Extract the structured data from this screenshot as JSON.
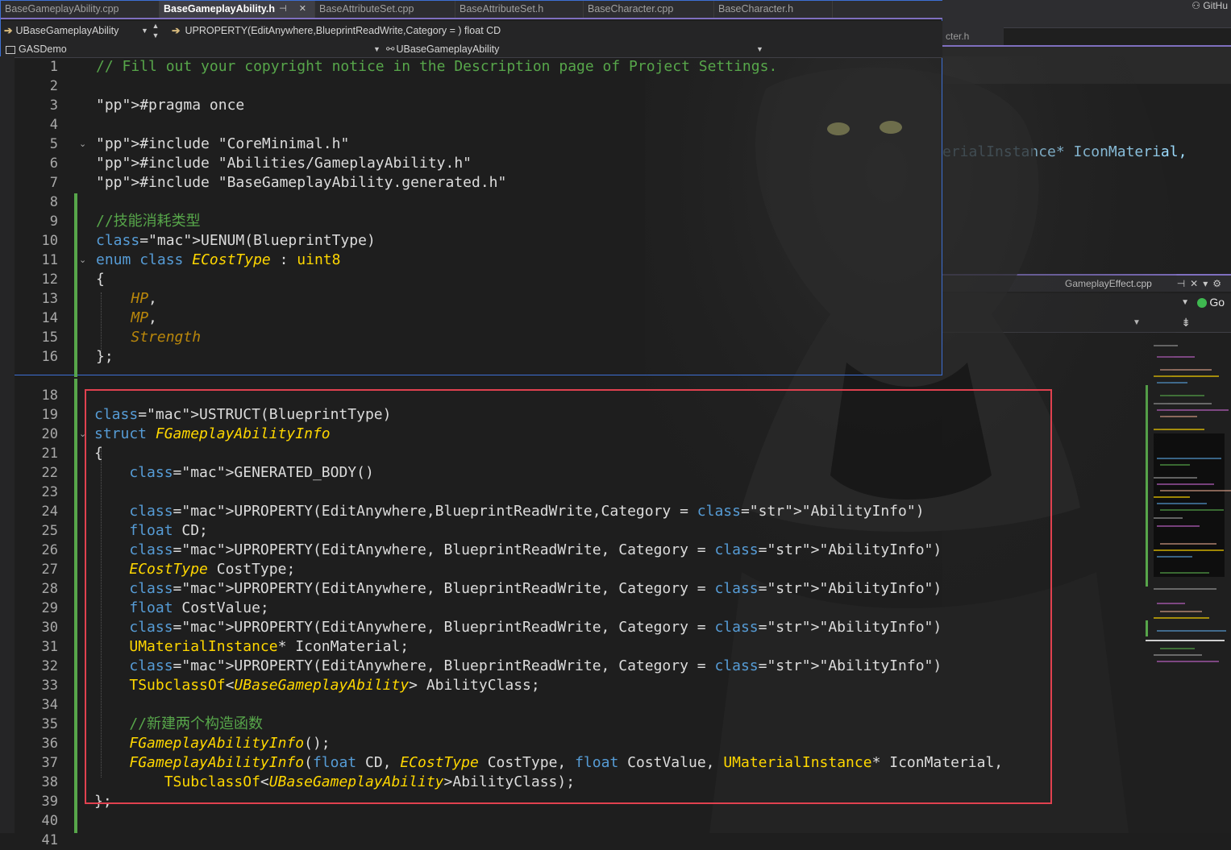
{
  "main_editor": {
    "tabs": [
      {
        "label": "BaseGameplayAbility.cpp",
        "active": false
      },
      {
        "label": "BaseGameplayAbility.h",
        "active": true
      },
      {
        "label": "BaseAttributeSet.cpp",
        "active": false
      },
      {
        "label": "BaseAttributeSet.h",
        "active": false
      },
      {
        "label": "BaseCharacter.cpp",
        "active": false
      },
      {
        "label": "BaseCharacter.h",
        "active": false
      }
    ],
    "active_tab_icons": "⊣ ✕",
    "nav": {
      "class_selector": "UBaseGameplayAbility",
      "member_selector": "UPROPERTY(EditAnywhere,BlueprintReadWrite,Category = ) float CD",
      "project": "GASDemo",
      "scope": "UBaseGameplayAbility"
    },
    "code_lines": [
      {
        "n": "1",
        "text": "// Fill out your copyright notice in the Description page of Project Settings."
      },
      {
        "n": "2",
        "text": ""
      },
      {
        "n": "3",
        "text": "#pragma once"
      },
      {
        "n": "4",
        "text": ""
      },
      {
        "n": "5",
        "text": "#include \"CoreMinimal.h\""
      },
      {
        "n": "6",
        "text": "#include \"Abilities/GameplayAbility.h\""
      },
      {
        "n": "7",
        "text": "#include \"BaseGameplayAbility.generated.h\""
      },
      {
        "n": "8",
        "text": ""
      },
      {
        "n": "9",
        "text": "//技能消耗类型"
      },
      {
        "n": "10",
        "text": "UENUM(BlueprintType)"
      },
      {
        "n": "11",
        "text": "enum class ECostType : uint8"
      },
      {
        "n": "12",
        "text": "{"
      },
      {
        "n": "13",
        "text": "    HP,"
      },
      {
        "n": "14",
        "text": "    MP,"
      },
      {
        "n": "15",
        "text": "    Strength"
      },
      {
        "n": "16",
        "text": "};"
      },
      {
        "n": "18",
        "text": ""
      },
      {
        "n": "19",
        "text": "USTRUCT(BlueprintType)"
      },
      {
        "n": "20",
        "text": "struct FGameplayAbilityInfo"
      },
      {
        "n": "21",
        "text": "{"
      },
      {
        "n": "22",
        "text": "    GENERATED_BODY()"
      },
      {
        "n": "23",
        "text": ""
      },
      {
        "n": "24",
        "text": "    UPROPERTY(EditAnywhere,BlueprintReadWrite,Category = \"AbilityInfo\")"
      },
      {
        "n": "25",
        "text": "    float CD;"
      },
      {
        "n": "26",
        "text": "    UPROPERTY(EditAnywhere, BlueprintReadWrite, Category = \"AbilityInfo\")"
      },
      {
        "n": "27",
        "text": "    ECostType CostType;"
      },
      {
        "n": "28",
        "text": "    UPROPERTY(EditAnywhere, BlueprintReadWrite, Category = \"AbilityInfo\")"
      },
      {
        "n": "29",
        "text": "    float CostValue;"
      },
      {
        "n": "30",
        "text": "    UPROPERTY(EditAnywhere, BlueprintReadWrite, Category = \"AbilityInfo\")"
      },
      {
        "n": "31",
        "text": "    UMaterialInstance* IconMaterial;"
      },
      {
        "n": "32",
        "text": "    UPROPERTY(EditAnywhere, BlueprintReadWrite, Category = \"AbilityInfo\")"
      },
      {
        "n": "33",
        "text": "    TSubclassOf<UBaseGameplayAbility> AbilityClass;"
      },
      {
        "n": "34",
        "text": ""
      },
      {
        "n": "35",
        "text": "    //新建两个构造函数"
      },
      {
        "n": "36",
        "text": "    FGameplayAbilityInfo();"
      },
      {
        "n": "37",
        "text": "    FGameplayAbilityInfo(float CD, ECostType CostType, float CostValue, UMaterialInstance* IconMaterial,"
      },
      {
        "n": "38",
        "text": "        TSubclassOf<UBaseGameplayAbility>AbilityClass);"
      },
      {
        "n": "39",
        "text": "};"
      },
      {
        "n": "40",
        "text": ""
      },
      {
        "n": "41",
        "text": ""
      }
    ]
  },
  "background_editor": {
    "github_label": "GitHu",
    "tab_fragment": "cter.h",
    "code_fragment": "erialInstance* IconMaterial,"
  },
  "secondary_pane": {
    "tab_label": "GameplayEffect.cpp",
    "go_label": "Go"
  },
  "colors": {
    "accent_purple": "#7f6fbf",
    "window_border": "#3d6fd4",
    "highlight_box": "#e0414f",
    "change_bar": "#57a64a"
  }
}
